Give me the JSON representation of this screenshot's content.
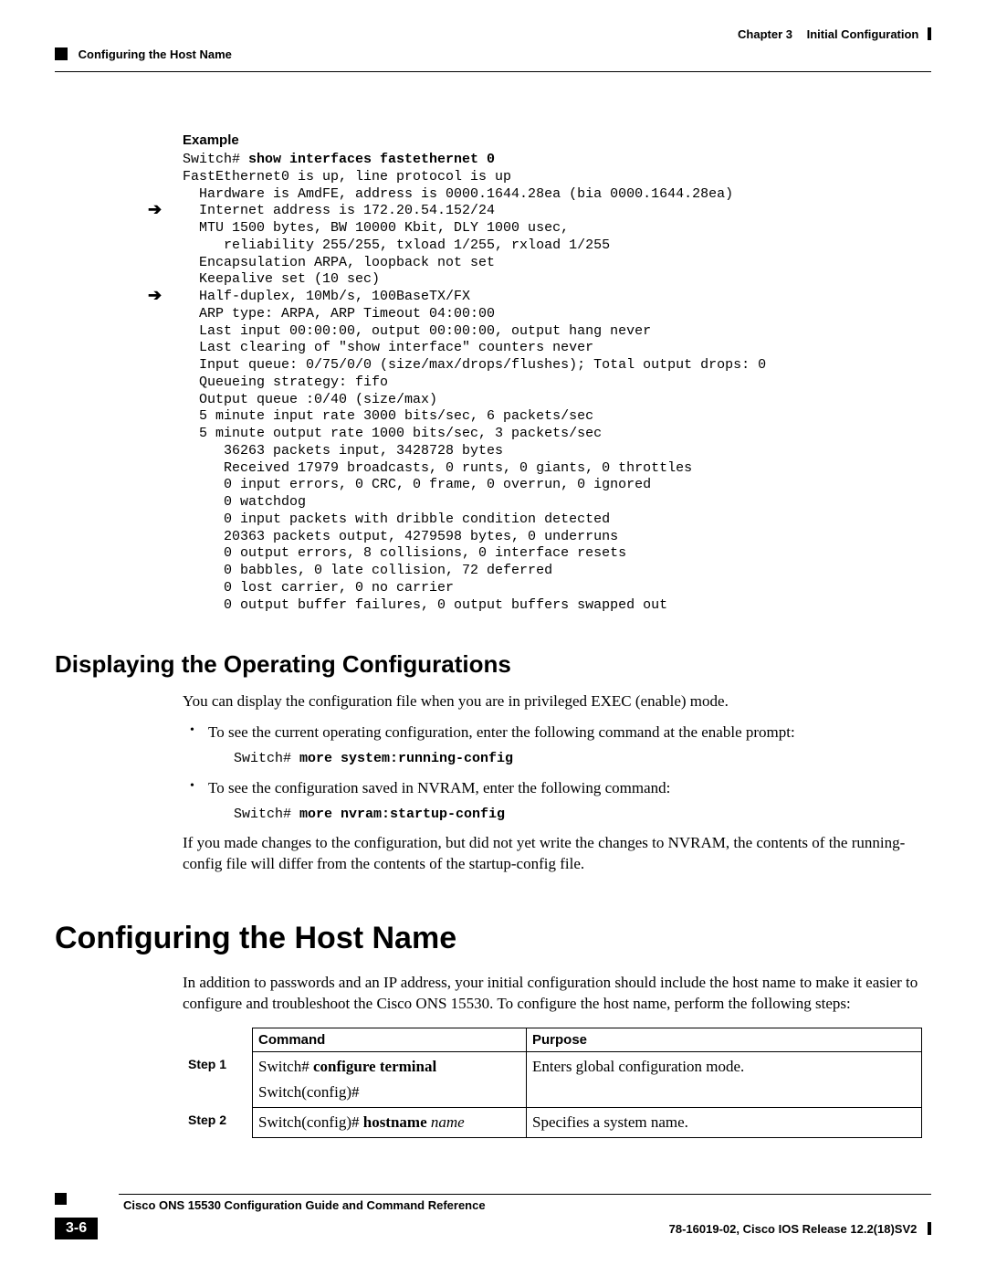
{
  "header": {
    "chapter_label": "Chapter 3",
    "chapter_title": "Initial Configuration",
    "section_title": "Configuring the Host Name"
  },
  "example": {
    "label": "Example",
    "prompt": "Switch#",
    "command": "show interfaces fastethernet 0",
    "output_lines": [
      "FastEthernet0 is up, line protocol is up",
      "  Hardware is AmdFE, address is 0000.1644.28ea (bia 0000.1644.28ea)",
      "  Internet address is 172.20.54.152/24",
      "  MTU 1500 bytes, BW 10000 Kbit, DLY 1000 usec,",
      "     reliability 255/255, txload 1/255, rxload 1/255",
      "  Encapsulation ARPA, loopback not set",
      "  Keepalive set (10 sec)",
      "  Half-duplex, 10Mb/s, 100BaseTX/FX",
      "  ARP type: ARPA, ARP Timeout 04:00:00",
      "  Last input 00:00:00, output 00:00:00, output hang never",
      "  Last clearing of \"show interface\" counters never",
      "  Input queue: 0/75/0/0 (size/max/drops/flushes); Total output drops: 0",
      "  Queueing strategy: fifo",
      "  Output queue :0/40 (size/max)",
      "  5 minute input rate 3000 bits/sec, 6 packets/sec",
      "  5 minute output rate 1000 bits/sec, 3 packets/sec",
      "     36263 packets input, 3428728 bytes",
      "     Received 17979 broadcasts, 0 runts, 0 giants, 0 throttles",
      "     0 input errors, 0 CRC, 0 frame, 0 overrun, 0 ignored",
      "     0 watchdog",
      "     0 input packets with dribble condition detected",
      "     20363 packets output, 4279598 bytes, 0 underruns",
      "     0 output errors, 8 collisions, 0 interface resets",
      "     0 babbles, 0 late collision, 72 deferred",
      "     0 lost carrier, 0 no carrier",
      "     0 output buffer failures, 0 output buffers swapped out"
    ],
    "arrow_line_indices": [
      2,
      7
    ]
  },
  "section_display": {
    "heading": "Displaying the Operating Configurations",
    "intro": "You can display the configuration file when you are in privileged EXEC (enable) mode.",
    "bullets": [
      {
        "text": "To see the current operating configuration, enter the following command at the enable prompt:",
        "cmd_prompt": "Switch#",
        "cmd_bold": "more system:running-config"
      },
      {
        "text": "To see the configuration saved in NVRAM, enter the following command:",
        "cmd_prompt": "Switch#",
        "cmd_bold": "more nvram:startup-config"
      }
    ],
    "closing": "If you made changes to the configuration, but did not yet write the changes to NVRAM, the contents of the running-config file will differ from the contents of the startup-config file."
  },
  "section_hostname": {
    "heading": "Configuring the Host Name",
    "intro": "In addition to passwords and an IP address, your initial configuration should include the host name to make it easier to configure and troubleshoot the Cisco ONS 15530. To configure the host name, perform the following steps:",
    "table": {
      "col_command": "Command",
      "col_purpose": "Purpose",
      "rows": [
        {
          "step": "Step 1",
          "command_prefix": "Switch#",
          "command_bold": "configure terminal",
          "command_italic": "",
          "command_line2": "Switch(config)#",
          "purpose": "Enters global configuration mode."
        },
        {
          "step": "Step 2",
          "command_prefix": "Switch(config)#",
          "command_bold": "hostname",
          "command_italic": "name",
          "command_line2": "",
          "purpose": "Specifies a system name."
        }
      ]
    }
  },
  "footer": {
    "guide_title": "Cisco ONS 15530 Configuration Guide and Command Reference",
    "page_number": "3-6",
    "doc_id": "78-16019-02, Cisco IOS Release 12.2(18)SV2"
  }
}
